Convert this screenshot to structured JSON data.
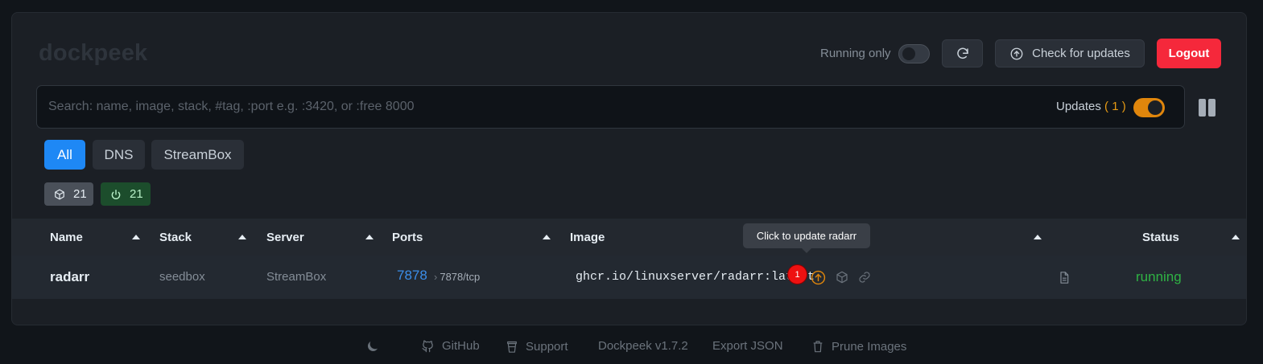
{
  "header": {
    "brand": "dockpeek",
    "running_only_label": "Running only",
    "check_updates_label": "Check for updates",
    "logout_label": "Logout"
  },
  "search": {
    "placeholder": "Search: name, image, stack, #tag, :port e.g. :3420, or :free 8000",
    "updates_label": "Updates",
    "updates_count": "( 1 )"
  },
  "filters": [
    {
      "label": "All",
      "active": true
    },
    {
      "label": "DNS",
      "active": false
    },
    {
      "label": "StreamBox",
      "active": false
    }
  ],
  "badges": {
    "total": "21",
    "running": "21"
  },
  "table": {
    "columns": [
      "Name",
      "Stack",
      "Server",
      "Ports",
      "Image",
      "Status"
    ],
    "rows": [
      {
        "name": "radarr",
        "stack": "seedbox",
        "server": "StreamBox",
        "port": "7878",
        "port_mapping": "7878/tcp",
        "image": "ghcr.io/linuxserver/radarr:latest",
        "status": "running",
        "update_count": "1"
      }
    ]
  },
  "tooltip": "Click to update radarr",
  "footer": {
    "github": "GitHub",
    "support": "Support",
    "version": "Dockpeek v1.7.2",
    "export": "Export JSON",
    "prune": "Prune Images"
  },
  "colors": {
    "accent": "#1e88f5",
    "logout": "#f5283b",
    "update": "#e0860c",
    "running": "#2fb344"
  }
}
